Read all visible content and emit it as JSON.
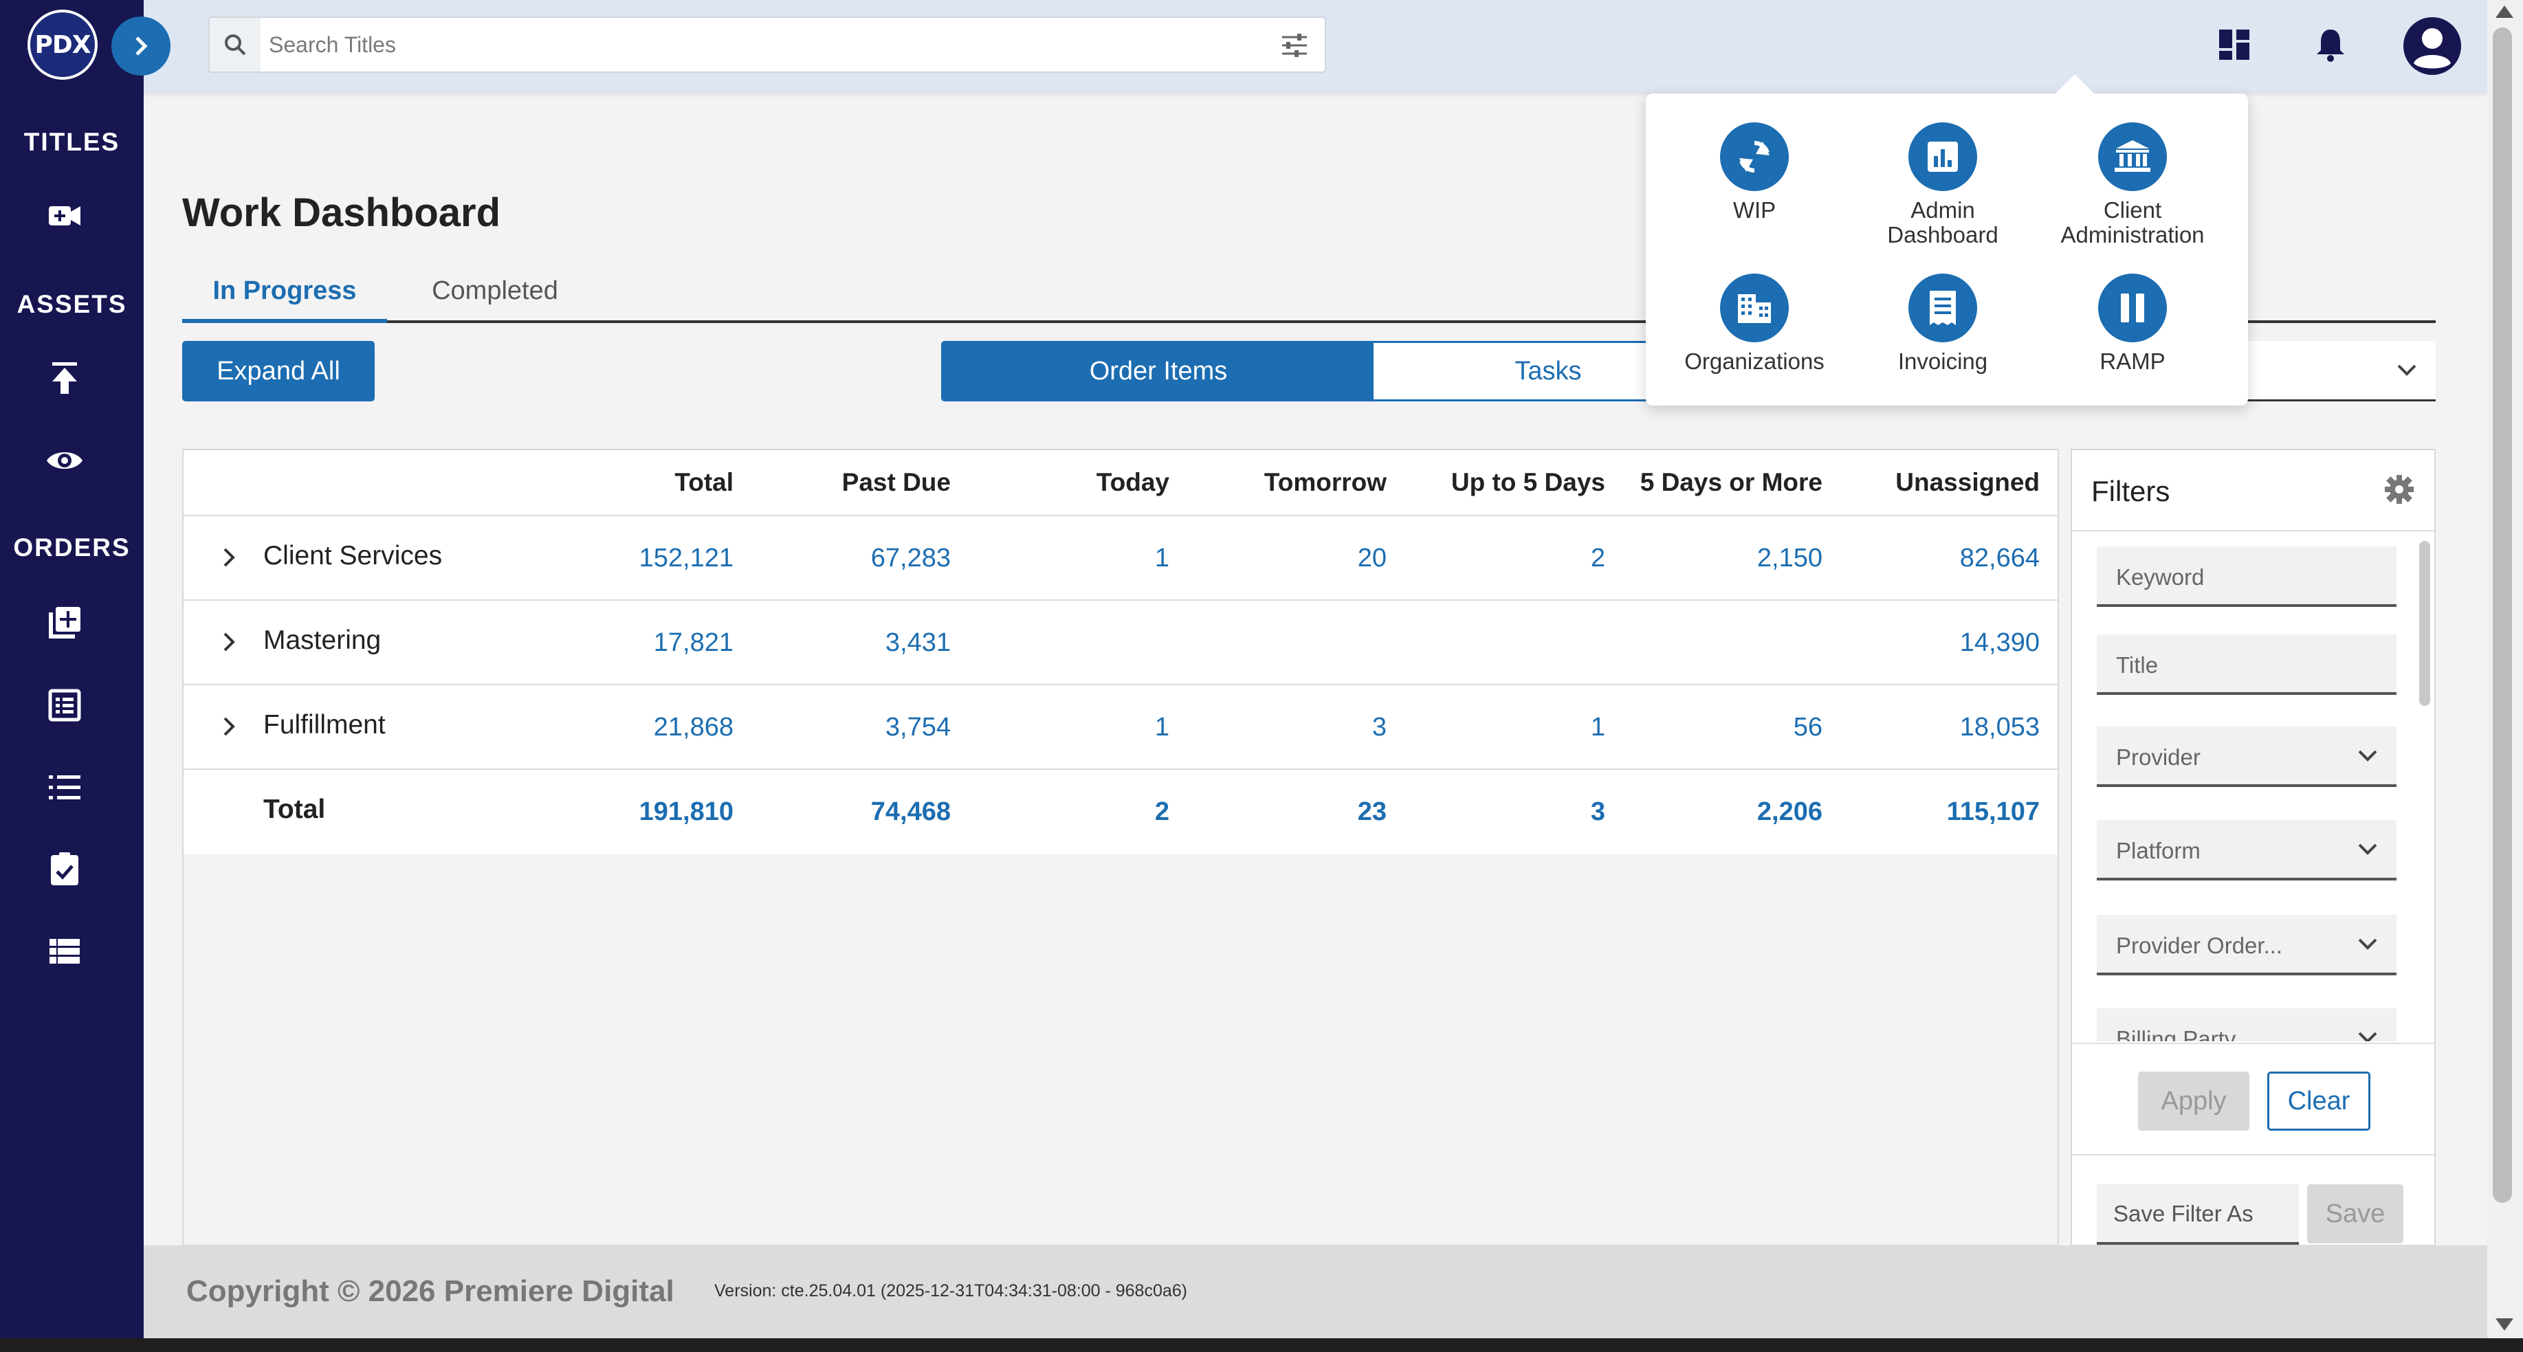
{
  "brand": {
    "logo_text": "PDX"
  },
  "search": {
    "placeholder": "Search Titles"
  },
  "sidebar": {
    "sections": [
      {
        "label": "TITLES"
      },
      {
        "label": "ASSETS"
      },
      {
        "label": "ORDERS"
      }
    ]
  },
  "page": {
    "title": "Work Dashboard"
  },
  "tabs": [
    {
      "label": "In Progress"
    },
    {
      "label": "Completed"
    }
  ],
  "toolbar": {
    "expand_all": "Expand All",
    "toggle_order_items": "Order Items",
    "toggle_tasks": "Tasks"
  },
  "table": {
    "headers": [
      "Total",
      "Past Due",
      "Today",
      "Tomorrow",
      "Up to 5 Days",
      "5 Days or More",
      "Unassigned"
    ],
    "rows": [
      {
        "name": "Client Services",
        "values": [
          "152,121",
          "67,283",
          "1",
          "20",
          "2",
          "2,150",
          "82,664"
        ]
      },
      {
        "name": "Mastering",
        "values": [
          "17,821",
          "3,431",
          "",
          "",
          "",
          "",
          "14,390"
        ]
      },
      {
        "name": "Fulfillment",
        "values": [
          "21,868",
          "3,754",
          "1",
          "3",
          "1",
          "56",
          "18,053"
        ]
      }
    ],
    "total": {
      "name": "Total",
      "values": [
        "191,810",
        "74,468",
        "2",
        "23",
        "3",
        "2,206",
        "115,107"
      ]
    }
  },
  "filters": {
    "title": "Filters",
    "fields": [
      "Keyword",
      "Title",
      "Provider",
      "Platform",
      "Provider Order...",
      "Billing Party"
    ],
    "apply": "Apply",
    "clear": "Clear",
    "save_filter_as": "Save Filter As",
    "save": "Save"
  },
  "app_menu": {
    "items": [
      {
        "label": "WIP",
        "icon": "sync-icon"
      },
      {
        "label": "Admin Dashboard",
        "icon": "bar-chart-icon"
      },
      {
        "label": "Client Administration",
        "icon": "bank-icon"
      },
      {
        "label": "Organizations",
        "icon": "building-icon"
      },
      {
        "label": "Invoicing",
        "icon": "receipt-icon"
      },
      {
        "label": "RAMP",
        "icon": "pause-icon"
      }
    ]
  },
  "footer": {
    "copyright": "Copyright © 2026 Premiere Digital",
    "version": "Version: cte.25.04.01 (2025-12-31T04:34:31-08:00 - 968c0a6)"
  },
  "colors": {
    "sidebar": "#171651",
    "accent": "#1c6db1",
    "topbar": "#dde6f1"
  }
}
